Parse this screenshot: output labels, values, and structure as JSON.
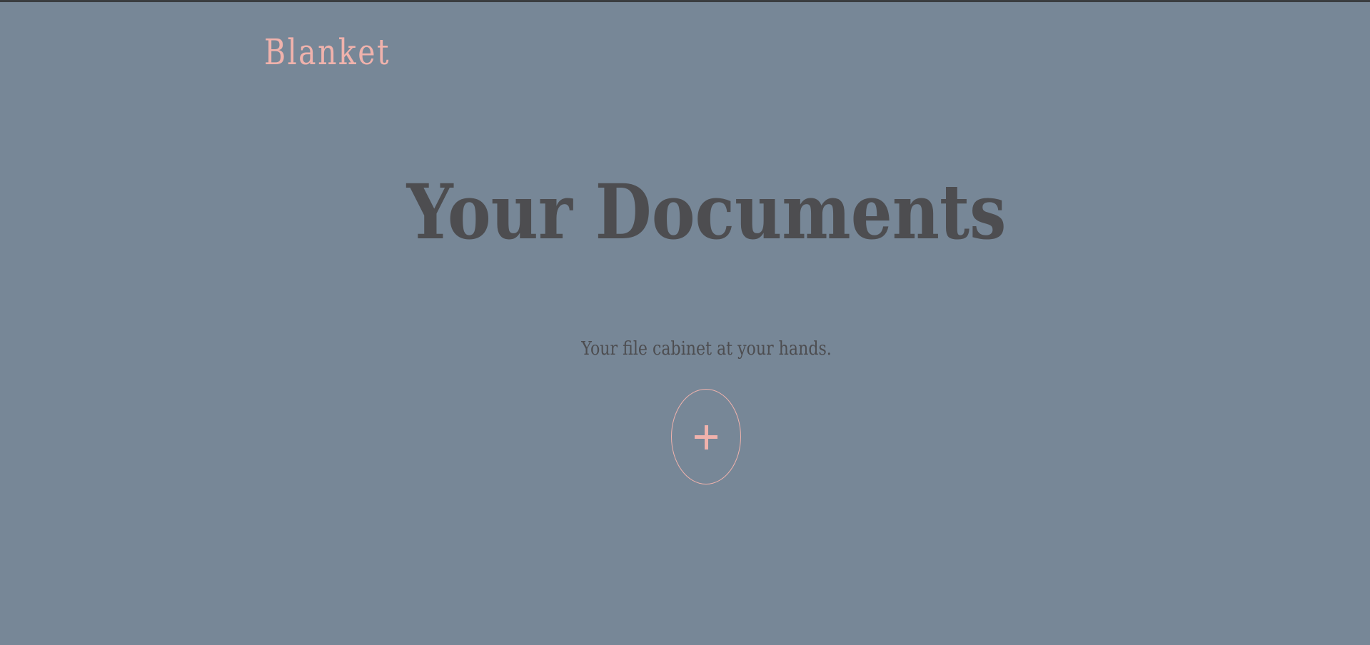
{
  "app": {
    "brand": "Blanket"
  },
  "hero": {
    "title": "Your Documents",
    "tagline": "Your file cabinet at your hands."
  },
  "actions": {
    "add_icon": "plus-icon"
  },
  "colors": {
    "background": "#778797",
    "accent": "#f0b2ac",
    "text": "#4d4d50",
    "top_border": "#3a3d40"
  }
}
